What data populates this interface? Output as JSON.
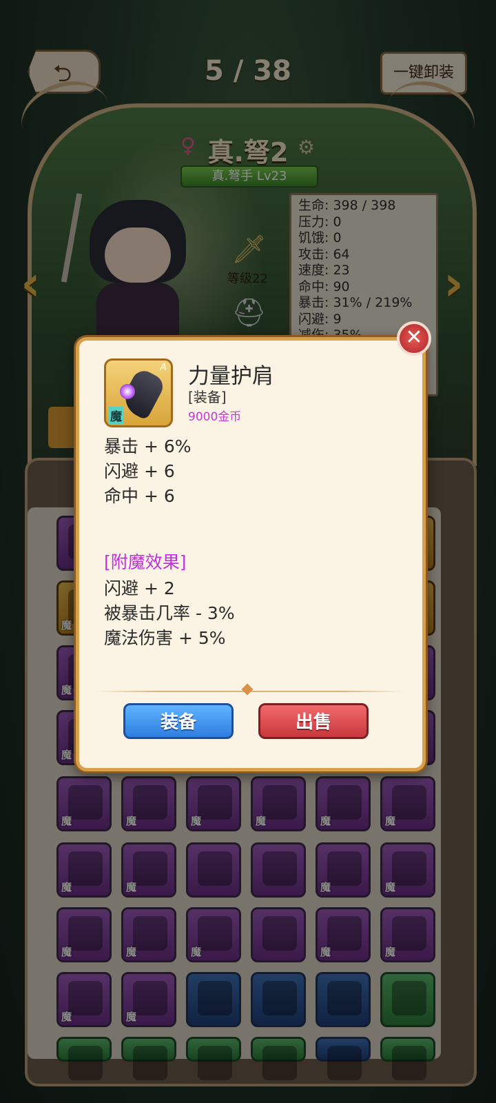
{
  "header": {
    "page_counter": "5 / 38",
    "unequip_all_label": "一键卸装"
  },
  "character": {
    "name": "真.弩2",
    "class_level": "真.弩手 Lv23",
    "weapon_level": "等级22",
    "stats": [
      "生命: 398 / 398",
      "压力: 0",
      "饥饿: 0",
      "攻击: 64",
      "速度: 23",
      "命中: 90",
      "暴击: 31% / 219%",
      "闪避: 9",
      "减伤: 35%"
    ]
  },
  "item_dialog": {
    "name": "力量护肩",
    "type": "[装备]",
    "price": "9000金币",
    "grade": "A",
    "tag": "魔",
    "stats": [
      "暴击 + 6%",
      "闪避 + 6",
      "命中 + 6"
    ],
    "enchant_title": "[附魔效果]",
    "enchant_stats": [
      "闪避 + 2",
      "被暴击几率 - 3%",
      "魔法伤害 + 5%"
    ],
    "equip_label": "装备",
    "sell_label": "出售"
  },
  "inventory": {
    "tag": "魔"
  },
  "colors": {
    "enchant": "#c12de0",
    "price": "#c23ad1",
    "equip_btn": "#2f7ee0",
    "sell_btn": "#c8383e"
  }
}
